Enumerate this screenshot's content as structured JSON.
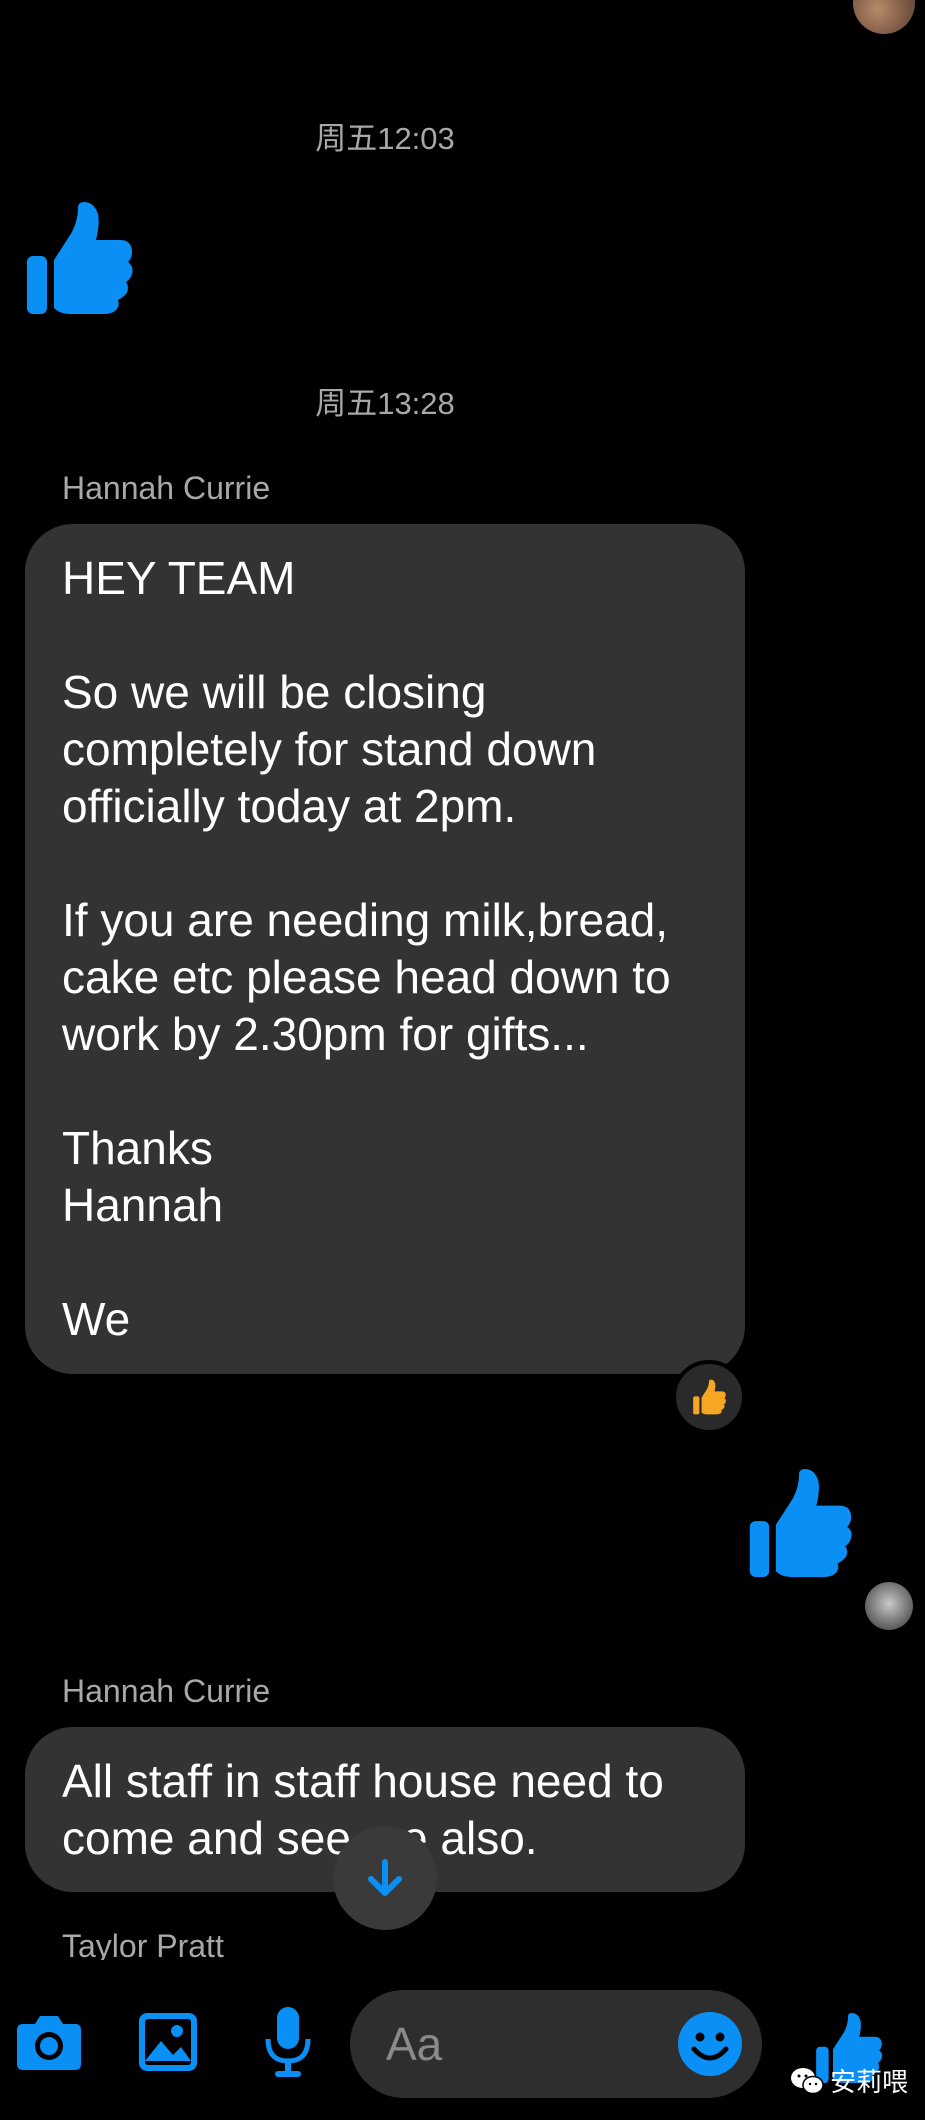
{
  "conversation": {
    "timestamps": [
      "周五12:03",
      "周五13:28"
    ],
    "messages": [
      {
        "sender": "Hannah Currie",
        "text": "HEY TEAM\n\nSo we will be closing\ncompletely for stand down\nofficially today at 2pm.\n\nIf you are needing milk,bread,\ncake etc please head down to\nwork by 2.30pm for gifts...\n\nThanks\nHannah\n\nWe"
      },
      {
        "sender": "Hannah Currie",
        "text": "All staff in staff house need to\ncome and see me also."
      },
      {
        "sender": "Taylor Pratt",
        "text": ""
      }
    ]
  },
  "composer": {
    "placeholder": "Aa",
    "icons": [
      "camera-icon",
      "gallery-icon",
      "microphone-icon",
      "emoji-icon",
      "like-icon"
    ]
  },
  "colors": {
    "accent": "#0a8ff5",
    "bubble": "#333333",
    "background": "#000000",
    "reaction": "#f5a623"
  },
  "watermark": {
    "text": "安莉喂"
  }
}
